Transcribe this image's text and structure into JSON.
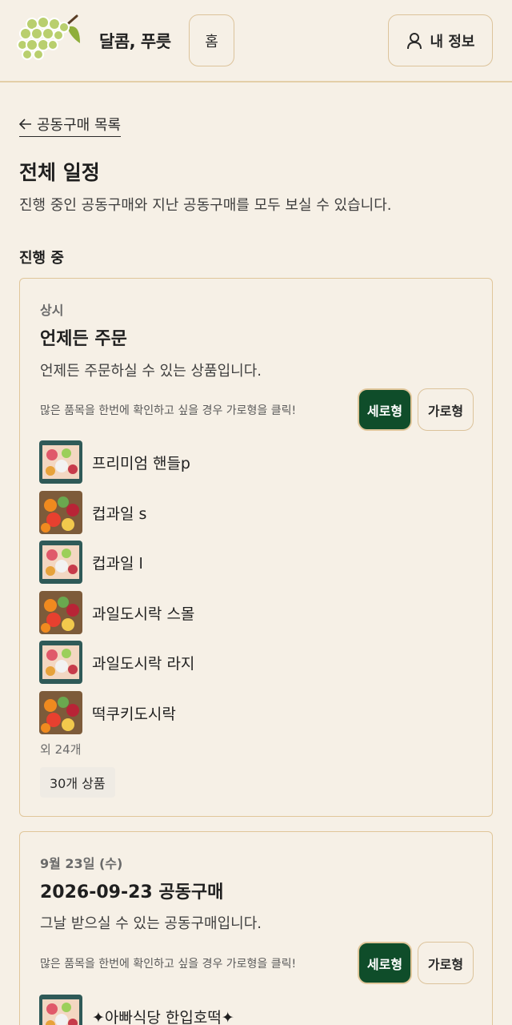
{
  "header": {
    "brand": "달콤, 푸릇",
    "home_label": "홈",
    "my_info_label": "내 정보"
  },
  "nav": {
    "back_label": "공동구매 목록"
  },
  "page": {
    "title": "전체 일정",
    "description": "진행 중인 공동구매와 지난 공동구매를 모두 보실 수 있습니다."
  },
  "section": {
    "title": "진행 중"
  },
  "cards": [
    {
      "tag": "상시",
      "title": "언제든 주문",
      "description": "언제든 주문하실 수 있는 상품입니다.",
      "hint": "많은 품목을 한번에 확인하고 싶을 경우 가로형을 클릭!",
      "vertical_label": "세로형",
      "horizontal_label": "가로형",
      "items": [
        {
          "name": "프리미엄 핸들p",
          "thumb": "fruit-box-icon"
        },
        {
          "name": "컵과일 s",
          "thumb": "fruit-basket-icon"
        },
        {
          "name": "컵과일 l",
          "thumb": "fruit-box-icon"
        },
        {
          "name": "과일도시락 스몰",
          "thumb": "fruit-basket-icon"
        },
        {
          "name": "과일도시락 라지",
          "thumb": "fruit-box-icon"
        },
        {
          "name": "떡쿠키도시락",
          "thumb": "fruit-basket-icon"
        }
      ],
      "more_text": "외 24개",
      "count_badge": "30개 상품"
    },
    {
      "tag": "9월 23일 (수)",
      "title": "2026-09-23 공동구매",
      "description": "그날 받으실 수 있는 공동구매입니다.",
      "hint": "많은 품목을 한번에 확인하고 싶을 경우 가로형을 클릭!",
      "vertical_label": "세로형",
      "horizontal_label": "가로형",
      "items": [
        {
          "name": "✦아빠식당 한입호떡✦",
          "thumb": "fruit-box-icon"
        }
      ]
    }
  ],
  "colors": {
    "background": "#f6f0e6",
    "border": "#e0c69a",
    "accent_green": "#0f4d2a"
  }
}
